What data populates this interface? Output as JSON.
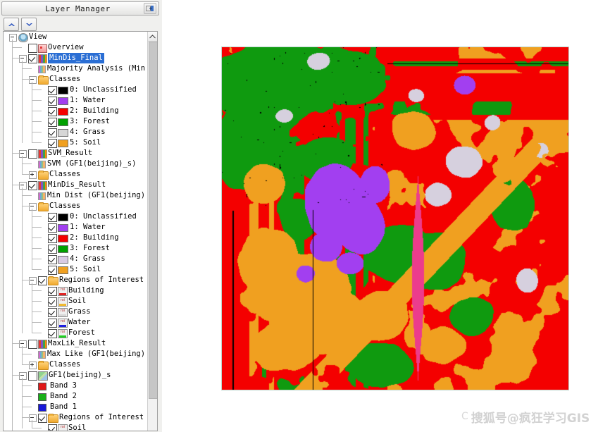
{
  "panel": {
    "title": "Layer Manager",
    "dock_icon": "dock-panel-icon",
    "toolbar": [
      {
        "name": "move-layer-up-button",
        "icon": "chevron-up-icon"
      },
      {
        "name": "move-layer-down-button",
        "icon": "chevron-down-icon"
      }
    ],
    "scrollbar": {
      "up_arrow": "scroll-up-arrow"
    }
  },
  "tree": [
    {
      "id": "view",
      "label": "View",
      "indent": 0,
      "icon": "globe-icon",
      "expander": "minus",
      "checkbox": null,
      "selected": false
    },
    {
      "id": "overview",
      "label": "Overview",
      "indent": 1,
      "icon": "monitor-icon",
      "expander": null,
      "checkbox": "off",
      "selected": false
    },
    {
      "id": "mindis_final",
      "label": "MinDis_Final",
      "indent": 1,
      "icon": "classification-grid-icon",
      "expander": "minus",
      "checkbox": "on",
      "selected": true
    },
    {
      "id": "majority_analysis",
      "label": "Majority Analysis (Min",
      "indent": 2,
      "icon": "raster-small-icon",
      "expander": null,
      "checkbox": null,
      "selected": false
    },
    {
      "id": "classes_1",
      "label": "Classes",
      "indent": 2,
      "icon": "folder-icon",
      "expander": "minus",
      "checkbox": null,
      "selected": false
    },
    {
      "id": "c1_0",
      "label": "0: Unclassified",
      "indent": 3,
      "swatch": "#000000",
      "checkbox": "on"
    },
    {
      "id": "c1_1",
      "label": "1: Water",
      "indent": 3,
      "swatch": "#a23ff0",
      "checkbox": "on"
    },
    {
      "id": "c1_2",
      "label": "2: Building",
      "indent": 3,
      "swatch": "#f40000",
      "checkbox": "on"
    },
    {
      "id": "c1_3",
      "label": "3: Forest",
      "indent": 3,
      "swatch": "#00a000",
      "checkbox": "on"
    },
    {
      "id": "c1_4",
      "label": "4: Grass",
      "indent": 3,
      "swatch": "#d6d6d6",
      "checkbox": "on"
    },
    {
      "id": "c1_5",
      "label": "5: Soil",
      "indent": 3,
      "swatch": "#f0a020",
      "checkbox": "on"
    },
    {
      "id": "svm_result",
      "label": "SVM_Result",
      "indent": 1,
      "icon": "classification-grid-icon",
      "expander": "minus",
      "checkbox": "off",
      "selected": false
    },
    {
      "id": "svm_file",
      "label": "SVM (GF1(beijing)_s)",
      "indent": 2,
      "icon": "raster-small-icon",
      "expander": null,
      "checkbox": null,
      "selected": false
    },
    {
      "id": "classes_svm",
      "label": "Classes",
      "indent": 2,
      "icon": "folder-icon",
      "expander": "plus",
      "checkbox": null,
      "selected": false
    },
    {
      "id": "mindis_result",
      "label": "MinDis_Result",
      "indent": 1,
      "icon": "classification-grid-icon",
      "expander": "minus",
      "checkbox": "on",
      "selected": false
    },
    {
      "id": "mindist_file",
      "label": "Min Dist (GF1(beijing)",
      "indent": 2,
      "icon": "raster-small-icon",
      "expander": null,
      "checkbox": null,
      "selected": false
    },
    {
      "id": "classes_2",
      "label": "Classes",
      "indent": 2,
      "icon": "folder-icon",
      "expander": "minus",
      "checkbox": null,
      "selected": false
    },
    {
      "id": "c2_0",
      "label": "0: Unclassified",
      "indent": 3,
      "swatch": "#000000",
      "checkbox": "on"
    },
    {
      "id": "c2_1",
      "label": "1: Water",
      "indent": 3,
      "swatch": "#a23ff0",
      "checkbox": "on"
    },
    {
      "id": "c2_2",
      "label": "2: Building",
      "indent": 3,
      "swatch": "#f40000",
      "checkbox": "on"
    },
    {
      "id": "c2_3",
      "label": "3: Forest",
      "indent": 3,
      "swatch": "#00a000",
      "checkbox": "on"
    },
    {
      "id": "c2_4",
      "label": "4: Grass",
      "indent": 3,
      "swatch": "#d9cbe4",
      "checkbox": "on"
    },
    {
      "id": "c2_5",
      "label": "5: Soil",
      "indent": 3,
      "swatch": "#f0a020",
      "checkbox": "on"
    },
    {
      "id": "roi_1",
      "label": "Regions of Interest",
      "indent": 2,
      "icon": "folder-icon",
      "expander": "minus",
      "checkbox": "on",
      "selected": false
    },
    {
      "id": "roi_building",
      "label": "Building",
      "indent": 3,
      "icon": "roi-icon",
      "roi_color": "#e02020",
      "checkbox": "on"
    },
    {
      "id": "roi_soil",
      "label": "Soil",
      "indent": 3,
      "icon": "roi-icon",
      "roi_color": "#f0b830",
      "checkbox": "on"
    },
    {
      "id": "roi_grass",
      "label": "Grass",
      "indent": 3,
      "icon": "roi-icon",
      "roi_color": "#d8d8d8",
      "checkbox": "on"
    },
    {
      "id": "roi_water",
      "label": "Water",
      "indent": 3,
      "icon": "roi-icon",
      "roi_color": "#2020e0",
      "checkbox": "on"
    },
    {
      "id": "roi_forest",
      "label": "Forest",
      "indent": 3,
      "icon": "roi-icon",
      "roi_color": "#20d020",
      "checkbox": "on"
    },
    {
      "id": "maxlik_result",
      "label": "MaxLik_Result",
      "indent": 1,
      "icon": "classification-grid-icon",
      "expander": "minus",
      "checkbox": "off",
      "selected": false
    },
    {
      "id": "maxlike_file",
      "label": "Max Like (GF1(beijing)",
      "indent": 2,
      "icon": "raster-small-icon",
      "expander": null,
      "checkbox": null,
      "selected": false
    },
    {
      "id": "classes_maxlik",
      "label": "Classes",
      "indent": 2,
      "icon": "folder-icon",
      "expander": "plus",
      "checkbox": null,
      "selected": false
    },
    {
      "id": "gf1_file",
      "label": "GF1(beijing)_s",
      "indent": 1,
      "icon": "rgb-image-icon",
      "expander": "minus",
      "checkbox": "off",
      "selected": false
    },
    {
      "id": "band3",
      "label": "Band 3",
      "indent": 2,
      "swatch": "#e01818",
      "checkbox": null
    },
    {
      "id": "band2",
      "label": "Band 2",
      "indent": 2,
      "swatch": "#18b018",
      "checkbox": null
    },
    {
      "id": "band1",
      "label": "Band 1",
      "indent": 2,
      "swatch": "#1818d8",
      "checkbox": null
    },
    {
      "id": "roi_2",
      "label": "Regions of Interest",
      "indent": 2,
      "icon": "folder-icon",
      "expander": "minus",
      "checkbox": "on",
      "selected": false
    },
    {
      "id": "roi2_soil",
      "label": "Soil",
      "indent": 3,
      "icon": "roi-icon",
      "roi_color": "#f0b830",
      "checkbox": "on"
    }
  ],
  "map": {
    "name": "classification-result-image",
    "classes": [
      {
        "name": "Unclassified",
        "color": "#000000"
      },
      {
        "name": "Water",
        "color": "#a23ff0"
      },
      {
        "name": "Building",
        "color": "#f40000"
      },
      {
        "name": "Forest",
        "color": "#0f9a0f"
      },
      {
        "name": "Grass",
        "color": "#d6d0de"
      },
      {
        "name": "Soil",
        "color": "#f0a020"
      }
    ],
    "border_color": "#bdd7cf"
  },
  "watermark": {
    "prefix": "C",
    "text": "搜狐号@疯狂学习GIS"
  }
}
